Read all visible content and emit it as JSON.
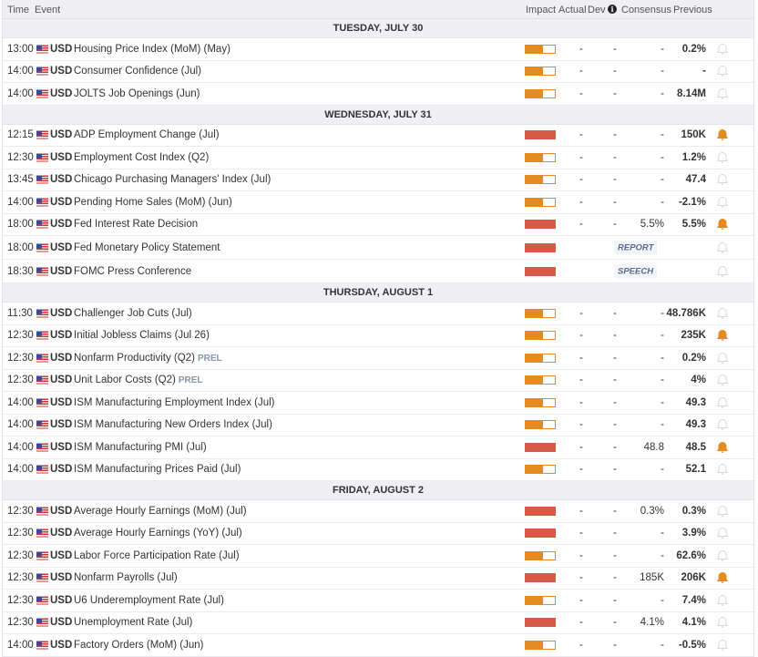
{
  "header": {
    "time": "Time",
    "event": "Event",
    "impact": "Impact",
    "actual": "Actual",
    "dev": "Dev",
    "consensus": "Consensus",
    "previous": "Previous",
    "info_icon": "i"
  },
  "colors": {
    "high": "#d55a48",
    "medium": "#e48b22",
    "bell_active": "#e48b22"
  },
  "days": [
    {
      "label": "TUESDAY, JULY 30",
      "rows": [
        {
          "time": "13:00",
          "cur": "USD",
          "event": "Housing Price Index (MoM) (May)",
          "impact": "medium",
          "actual": "-",
          "dev": "-",
          "cons": "-",
          "prev": "0.2%",
          "alert": false
        },
        {
          "time": "14:00",
          "cur": "USD",
          "event": "Consumer Confidence (Jul)",
          "impact": "medium",
          "actual": "-",
          "dev": "-",
          "cons": "-",
          "prev": "-",
          "alert": false
        },
        {
          "time": "14:00",
          "cur": "USD",
          "event": "JOLTS Job Openings (Jun)",
          "impact": "medium",
          "actual": "-",
          "dev": "-",
          "cons": "-",
          "prev": "8.14M",
          "alert": false
        }
      ]
    },
    {
      "label": "WEDNESDAY, JULY 31",
      "rows": [
        {
          "time": "12:15",
          "cur": "USD",
          "event": "ADP Employment Change (Jul)",
          "impact": "high",
          "actual": "-",
          "dev": "-",
          "cons": "-",
          "prev": "150K",
          "alert": true
        },
        {
          "time": "12:30",
          "cur": "USD",
          "event": "Employment Cost Index (Q2)",
          "impact": "medium",
          "actual": "-",
          "dev": "-",
          "cons": "-",
          "prev": "1.2%",
          "alert": false
        },
        {
          "time": "13:45",
          "cur": "USD",
          "event": "Chicago Purchasing Managers' Index (Jul)",
          "impact": "medium",
          "actual": "-",
          "dev": "-",
          "cons": "-",
          "prev": "47.4",
          "alert": false
        },
        {
          "time": "14:00",
          "cur": "USD",
          "event": "Pending Home Sales (MoM) (Jun)",
          "impact": "medium",
          "actual": "-",
          "dev": "-",
          "cons": "-",
          "prev": "-2.1%",
          "alert": false
        },
        {
          "time": "18:00",
          "cur": "USD",
          "event": "Fed Interest Rate Decision",
          "impact": "high",
          "actual": "-",
          "dev": "-",
          "cons": "5.5%",
          "prev": "5.5%",
          "alert": true
        },
        {
          "time": "18:00",
          "cur": "USD",
          "event": "Fed Monetary Policy Statement",
          "impact": "high",
          "badge": "REPORT",
          "alert": false
        },
        {
          "time": "18:30",
          "cur": "USD",
          "event": "FOMC Press Conference",
          "impact": "high",
          "badge": "SPEECH",
          "alert": false
        }
      ]
    },
    {
      "label": "THURSDAY, AUGUST 1",
      "rows": [
        {
          "time": "11:30",
          "cur": "USD",
          "event": "Challenger Job Cuts (Jul)",
          "impact": "medium",
          "actual": "-",
          "dev": "-",
          "cons": "-",
          "prev": "48.786K",
          "alert": false
        },
        {
          "time": "12:30",
          "cur": "USD",
          "event": "Initial Jobless Claims (Jul 26)",
          "impact": "medium",
          "actual": "-",
          "dev": "-",
          "cons": "-",
          "prev": "235K",
          "alert": true
        },
        {
          "time": "12:30",
          "cur": "USD",
          "event": "Nonfarm Productivity (Q2)",
          "tag": "PREL",
          "impact": "medium",
          "actual": "-",
          "dev": "-",
          "cons": "-",
          "prev": "0.2%",
          "alert": false
        },
        {
          "time": "12:30",
          "cur": "USD",
          "event": "Unit Labor Costs (Q2)",
          "tag": "PREL",
          "impact": "medium",
          "actual": "-",
          "dev": "-",
          "cons": "-",
          "prev": "4%",
          "alert": false
        },
        {
          "time": "14:00",
          "cur": "USD",
          "event": "ISM Manufacturing Employment Index (Jul)",
          "impact": "medium",
          "actual": "-",
          "dev": "-",
          "cons": "-",
          "prev": "49.3",
          "alert": false
        },
        {
          "time": "14:00",
          "cur": "USD",
          "event": "ISM Manufacturing New Orders Index (Jul)",
          "impact": "medium",
          "actual": "-",
          "dev": "-",
          "cons": "-",
          "prev": "49.3",
          "alert": false
        },
        {
          "time": "14:00",
          "cur": "USD",
          "event": "ISM Manufacturing PMI (Jul)",
          "impact": "high",
          "actual": "-",
          "dev": "-",
          "cons": "48.8",
          "prev": "48.5",
          "alert": true
        },
        {
          "time": "14:00",
          "cur": "USD",
          "event": "ISM Manufacturing Prices Paid (Jul)",
          "impact": "medium",
          "actual": "-",
          "dev": "-",
          "cons": "-",
          "prev": "52.1",
          "alert": false
        }
      ]
    },
    {
      "label": "FRIDAY, AUGUST 2",
      "rows": [
        {
          "time": "12:30",
          "cur": "USD",
          "event": "Average Hourly Earnings (MoM) (Jul)",
          "impact": "high",
          "actual": "-",
          "dev": "-",
          "cons": "0.3%",
          "prev": "0.3%",
          "alert": false
        },
        {
          "time": "12:30",
          "cur": "USD",
          "event": "Average Hourly Earnings (YoY) (Jul)",
          "impact": "high",
          "actual": "-",
          "dev": "-",
          "cons": "-",
          "prev": "3.9%",
          "alert": false
        },
        {
          "time": "12:30",
          "cur": "USD",
          "event": "Labor Force Participation Rate (Jul)",
          "impact": "medium",
          "actual": "-",
          "dev": "-",
          "cons": "-",
          "prev": "62.6%",
          "alert": false
        },
        {
          "time": "12:30",
          "cur": "USD",
          "event": "Nonfarm Payrolls (Jul)",
          "impact": "high",
          "actual": "-",
          "dev": "-",
          "cons": "185K",
          "prev": "206K",
          "alert": true
        },
        {
          "time": "12:30",
          "cur": "USD",
          "event": "U6 Underemployment Rate (Jul)",
          "impact": "medium",
          "actual": "-",
          "dev": "-",
          "cons": "-",
          "prev": "7.4%",
          "alert": false
        },
        {
          "time": "12:30",
          "cur": "USD",
          "event": "Unemployment Rate (Jul)",
          "impact": "high",
          "actual": "-",
          "dev": "-",
          "cons": "4.1%",
          "prev": "4.1%",
          "alert": false
        },
        {
          "time": "14:00",
          "cur": "USD",
          "event": "Factory Orders (MoM) (Jun)",
          "impact": "medium",
          "actual": "-",
          "dev": "-",
          "cons": "-",
          "prev": "-0.5%",
          "alert": false
        }
      ]
    }
  ]
}
